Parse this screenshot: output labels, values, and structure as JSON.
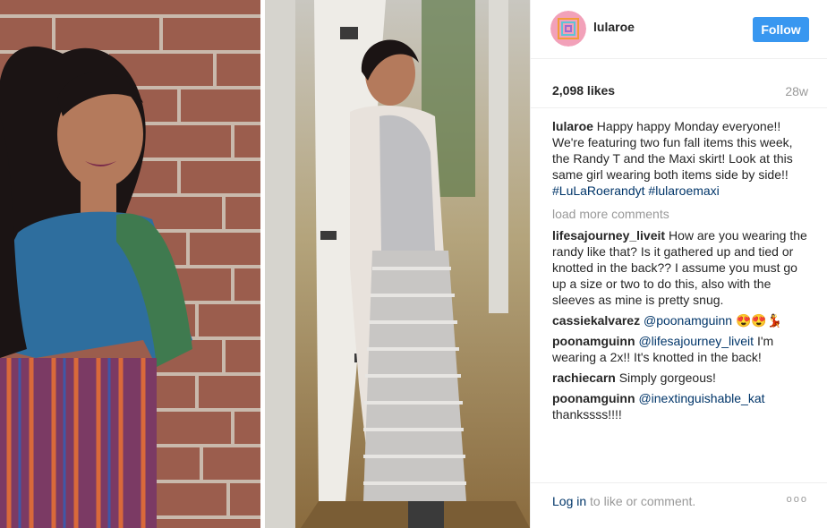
{
  "post": {
    "username": "lularoe",
    "follow_label": "Follow",
    "likes": "2,098 likes",
    "age": "28w"
  },
  "caption": {
    "username": "lularoe",
    "text": "Happy happy Monday everyone!! We're featuring two fun fall items this week, the Randy T and the Maxi skirt! Look at this same girl wearing both items side by side!!",
    "hashtag_1": "#LuLaRoerandyt",
    "hashtag_2": "#lularoemaxi"
  },
  "load_more": "load more comments",
  "comments": [
    {
      "username": "lifesajourney_liveit",
      "text": "How are you wearing the randy like that? Is it gathered up and tied or knotted in the back?? I assume you must go up a size or two to do this, also with the sleeves as mine is pretty snug."
    },
    {
      "username": "cassiekalvarez",
      "mention": "@poonamguinn",
      "text": "😍😍💃"
    },
    {
      "username": "poonamguinn",
      "mention": "@lifesajourney_liveit",
      "text": "I'm wearing a 2x!! It's knotted in the back!"
    },
    {
      "username": "rachiecarn",
      "text": "Simply gorgeous!"
    },
    {
      "username": "poonamguinn",
      "mention": "@inextinguishable_kat",
      "text": "thankssss!!!!"
    }
  ],
  "footer": {
    "login_link": "Log in",
    "login_text": "to like or comment.",
    "more": "ooo"
  },
  "icons": {
    "avatar": "lularoe-logo-icon",
    "more": "more-options-icon"
  },
  "colors": {
    "follow_button": "#3897f0",
    "link": "#003569",
    "muted": "#999999"
  }
}
